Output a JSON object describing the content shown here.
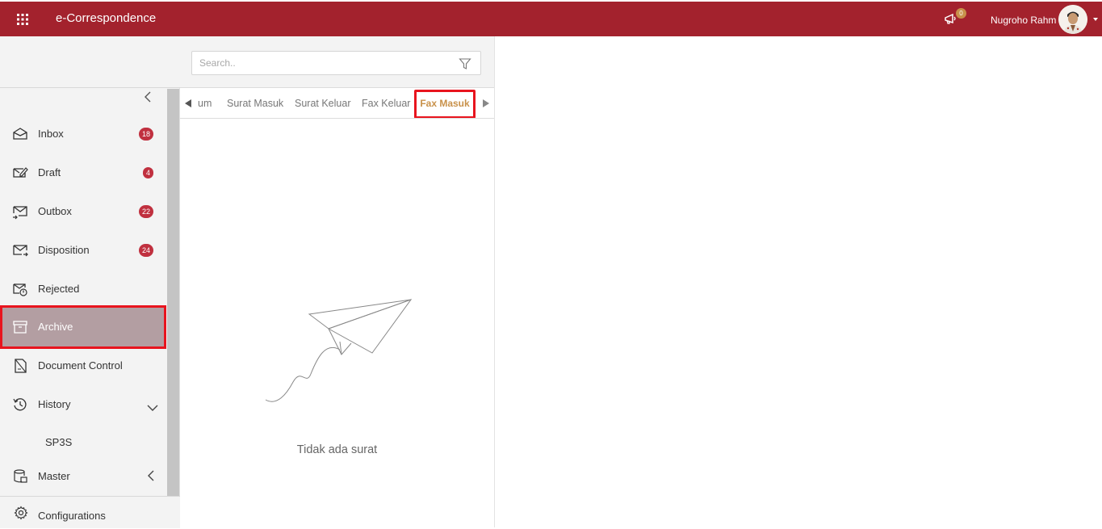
{
  "header": {
    "app_title": "e-Correspondence",
    "notification_count": "0",
    "user_name": "Nugroho Rahm",
    "brand_color": "#a3222d"
  },
  "sidebar": {
    "items": [
      {
        "label": "Inbox",
        "badge": "18",
        "icon": "inbox-icon"
      },
      {
        "label": "Draft",
        "badge": "4",
        "icon": "draft-icon"
      },
      {
        "label": "Outbox",
        "badge": "22",
        "icon": "outbox-icon"
      },
      {
        "label": "Disposition",
        "badge": "24",
        "icon": "disposition-icon"
      },
      {
        "label": "Rejected",
        "icon": "rejected-icon"
      },
      {
        "label": "Archive",
        "icon": "archive-icon",
        "active": true
      },
      {
        "label": "Document Control",
        "icon": "document-control-icon"
      },
      {
        "label": "History",
        "icon": "history-icon"
      },
      {
        "label": "SP3S"
      },
      {
        "label": "Master",
        "icon": "master-icon"
      },
      {
        "label": "Configurations",
        "icon": "gear-icon"
      }
    ]
  },
  "search": {
    "placeholder": "Search.."
  },
  "tabs": [
    {
      "label": "um"
    },
    {
      "label": "Surat Masuk"
    },
    {
      "label": "Surat Keluar"
    },
    {
      "label": "Fax Keluar"
    },
    {
      "label": "Fax Masuk",
      "active": true
    }
  ],
  "empty_state": {
    "message": "Tidak ada surat"
  }
}
